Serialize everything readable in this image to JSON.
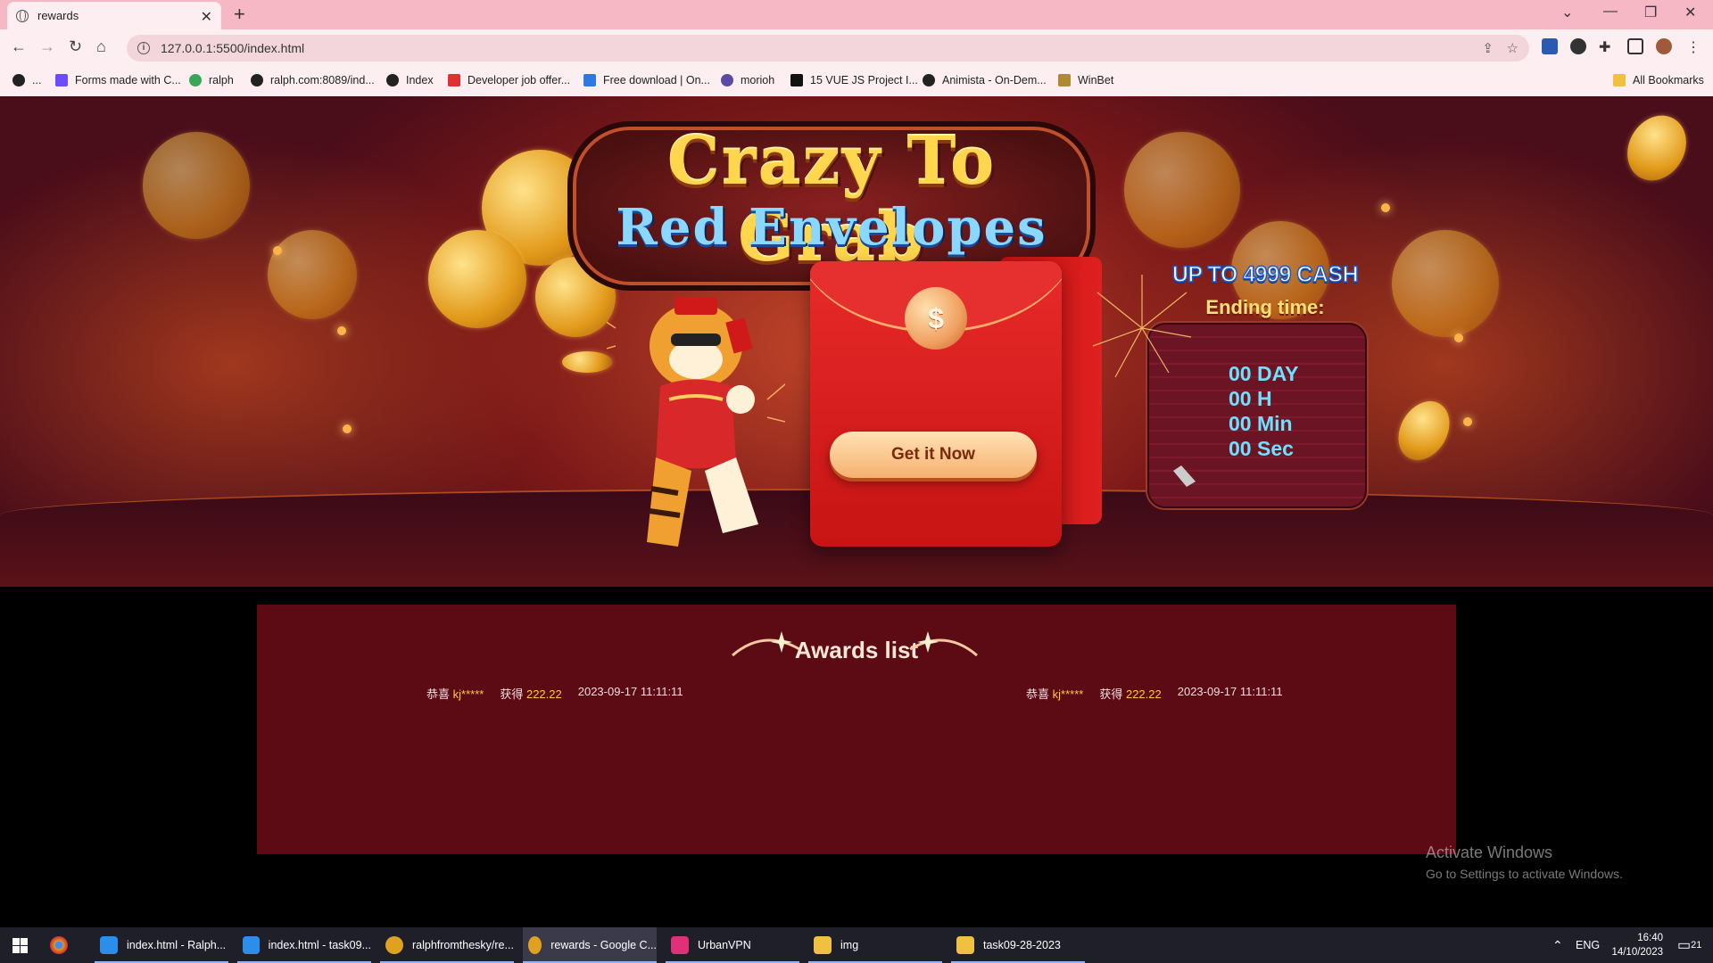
{
  "browser": {
    "tab_title": "rewards",
    "url": "127.0.0.1:5500/index.html",
    "bookmarks": [
      {
        "label": "...",
        "icon": "globe-icon",
        "color": "#222222"
      },
      {
        "label": "Forms made with C...",
        "icon": "ui-icon",
        "color": "#6b4cff"
      },
      {
        "label": "ralph",
        "icon": "globe-icon",
        "color": "#3aa757"
      },
      {
        "label": "ralph.com:8089/ind...",
        "icon": "globe-icon",
        "color": "#222222"
      },
      {
        "label": "Index",
        "icon": "globe-icon",
        "color": "#222222"
      },
      {
        "label": "Developer job offer...",
        "icon": "arrow-icon",
        "color": "#e03030"
      },
      {
        "label": "Free download | On...",
        "icon": "w-icon",
        "color": "#2a7ae2"
      },
      {
        "label": "morioh",
        "icon": "morioh-icon",
        "color": "#5a4aa8"
      },
      {
        "label": "15 VUE JS Project I...",
        "icon": "video-icon",
        "color": "#111111"
      },
      {
        "label": "Animista - On-Dem...",
        "icon": "a-icon",
        "color": "#222222"
      },
      {
        "label": "WinBet",
        "icon": "winbet-icon",
        "color": "#b08a30"
      }
    ],
    "all_bookmarks": "All Bookmarks"
  },
  "hero": {
    "title_line1": "Crazy To Grab",
    "title_line2": "Red Envelopes",
    "seal_symbol": "$",
    "cta_label": "Get it Now",
    "upto": "UP TO 4999 CASH",
    "ending_label": "Ending time:",
    "timer": {
      "day": "00 DAY",
      "hour": "00 H",
      "min": "00 Min",
      "sec": "00 Sec"
    }
  },
  "awards": {
    "title": "Awards list",
    "rows": [
      {
        "congrats": "恭喜",
        "user": "kj*****",
        "got": "获得",
        "amount": "222.22",
        "time": "2023-09-17 11:11:11"
      },
      {
        "congrats": "恭喜",
        "user": "kj*****",
        "got": "获得",
        "amount": "222.22",
        "time": "2023-09-17 11:11:11"
      }
    ]
  },
  "watermark": {
    "line1": "Activate Windows",
    "line2": "Go to Settings to activate Windows."
  },
  "taskbar": {
    "items": [
      {
        "label": "index.html - Ralph...",
        "icon": "vscode-icon",
        "color": "#2b8ee8"
      },
      {
        "label": "index.html - task09...",
        "icon": "vscode-icon",
        "color": "#2b8ee8"
      },
      {
        "label": "ralphfromthesky/re...",
        "icon": "chrome-icon",
        "color": "#e0a020"
      },
      {
        "label": "rewards - Google C...",
        "icon": "chrome-icon",
        "color": "#e0a020"
      },
      {
        "label": "UrbanVPN",
        "icon": "vpn-icon",
        "color": "#e0307a"
      },
      {
        "label": "img",
        "icon": "folder-icon",
        "color": "#f0c040"
      },
      {
        "label": "task09-28-2023",
        "icon": "folder-icon",
        "color": "#f0c040"
      }
    ],
    "lang": "ENG",
    "time": "16:40",
    "date": "14/10/2023",
    "notif_count": "21"
  }
}
